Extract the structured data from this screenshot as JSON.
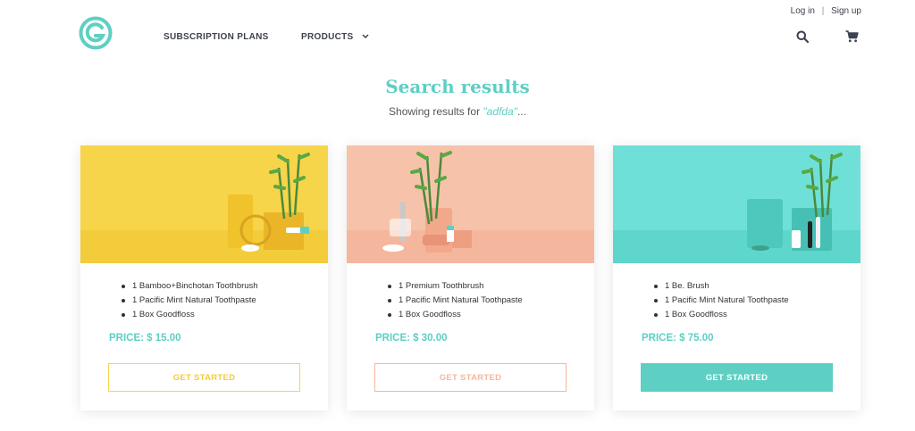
{
  "nav": {
    "subscription_plans": "SUBSCRIPTION PLANS",
    "products": "PRODUCTS",
    "login": "Log in",
    "separator": "|",
    "signup": "Sign up"
  },
  "icons": {
    "logo": "circle-g-logo",
    "search": "search-icon",
    "cart": "cart-icon",
    "products_dropdown": "chevron-down-icon"
  },
  "colors": {
    "accent": "#5ecfc3",
    "yellow": "#f6d54a",
    "peach": "#f6c3aa",
    "teal": "#6fe0d8"
  },
  "header": {
    "title": "Search results",
    "showing_prefix": "Showing results for ",
    "query": "\"adfda\"",
    "showing_suffix": "..."
  },
  "cards": [
    {
      "features": [
        "1 Bamboo+Binchotan Toothbrush",
        "1 Pacific Mint Natural Toothpaste",
        "1 Box Goodfloss"
      ],
      "price": "PRICE: $ 15.00",
      "button": "GET STARTED"
    },
    {
      "features": [
        "1 Premium Toothbrush",
        "1 Pacific Mint Natural Toothpaste",
        "1 Box Goodfloss"
      ],
      "price": "PRICE: $ 30.00",
      "button": "GET STARTED"
    },
    {
      "features": [
        "1 Be. Brush",
        "1 Pacific Mint Natural Toothpaste",
        "1 Box Goodfloss"
      ],
      "price": "PRICE: $ 75.00",
      "button": "GET STARTED"
    }
  ]
}
